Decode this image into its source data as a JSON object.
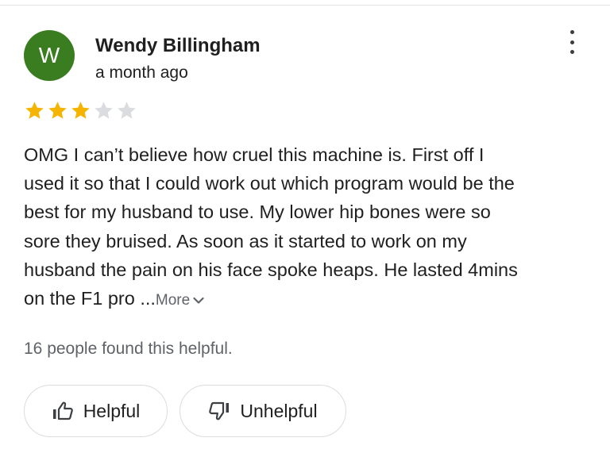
{
  "review": {
    "author": {
      "initial": "W",
      "name": "Wendy Billingham",
      "avatar_color": "#3a7d21"
    },
    "time_ago": "a month ago",
    "rating": 3,
    "max_rating": 5,
    "star_color_filled": "#f4b400",
    "star_color_empty": "#dadce0",
    "text_lines": [
      "OMG I can’t believe how cruel this machine is. First off I",
      "used it so that I could work out which program would be the",
      "best for my husband to use. My lower hip bones were so",
      "sore they bruised. As soon as it started to work on my",
      "husband the pain on his face spoke heaps. He lasted 4mins",
      "on the F1 pro ..."
    ],
    "more_label": "More",
    "helpful_count_text": "16 people found this helpful.",
    "actions": {
      "helpful_label": "Helpful",
      "unhelpful_label": "Unhelpful"
    },
    "icons": {
      "menu": "more-vert-icon",
      "thumbs_up": "thumbs-up-icon",
      "thumbs_down": "thumbs-down-icon",
      "expand": "chevron-down-icon"
    }
  }
}
